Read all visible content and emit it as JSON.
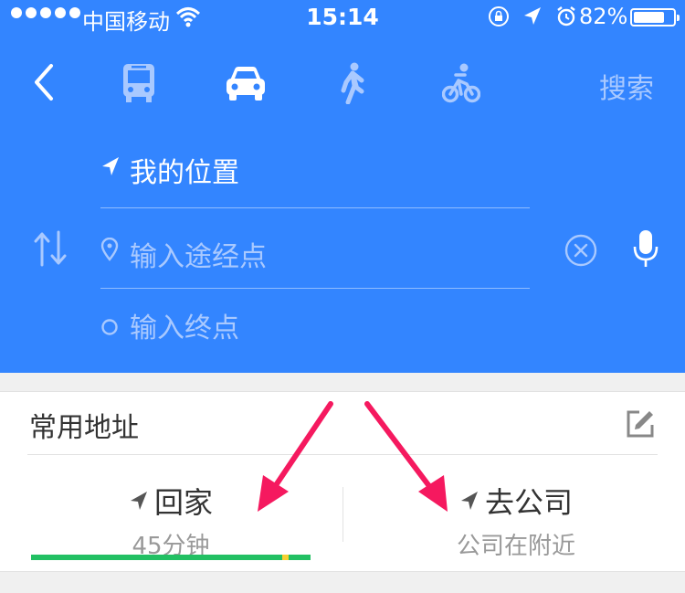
{
  "status_bar": {
    "carrier": "中国移动",
    "time": "15:14",
    "battery": "82%",
    "battery_level": 0.82
  },
  "nav": {
    "search_label": "搜索",
    "modes": [
      "bus-icon",
      "car-icon",
      "walk-icon",
      "bike-icon"
    ],
    "active_mode": "car-icon"
  },
  "route": {
    "origin": "我的位置",
    "waypoint_placeholder": "输入途经点",
    "destination_placeholder": "输入终点"
  },
  "favorites": {
    "title": "常用地址",
    "home": {
      "label": "回家",
      "detail": "45分钟"
    },
    "work": {
      "label": "去公司",
      "detail": "公司在附近"
    },
    "traffic": [
      {
        "color": "#22c063",
        "fraction": 0.9
      },
      {
        "color": "#f6d032",
        "fraction": 0.02
      },
      {
        "color": "#22c063",
        "fraction": 0.08
      }
    ]
  },
  "colors": {
    "header": "#3385ff",
    "annotation_arrow": "#f5195f"
  }
}
